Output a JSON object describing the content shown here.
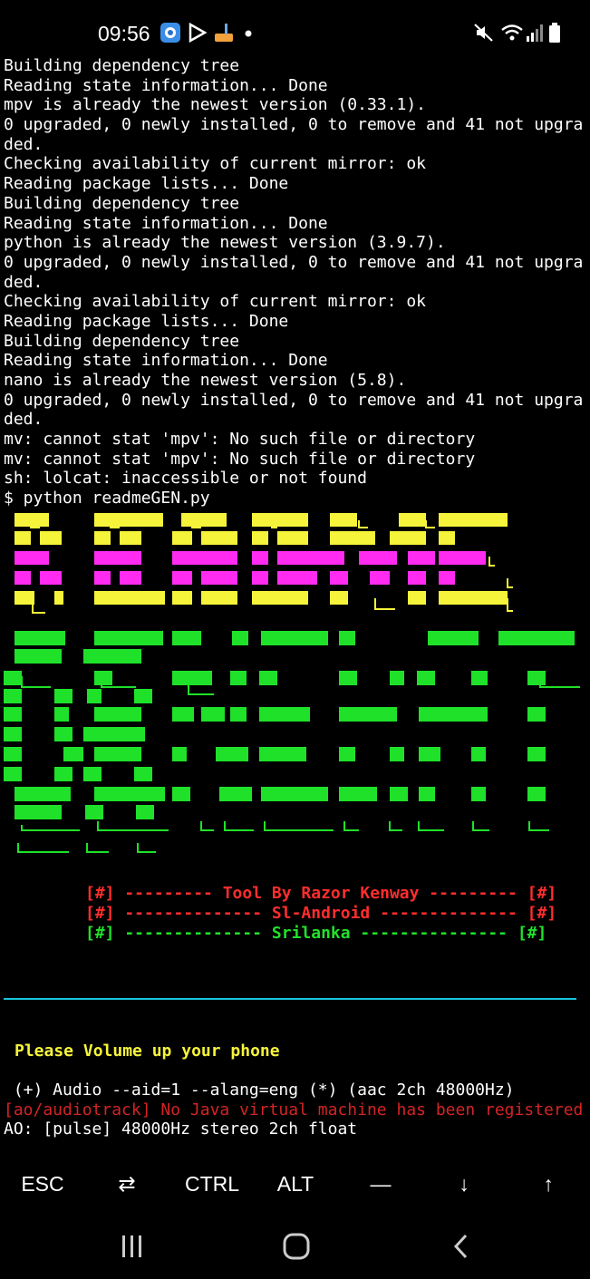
{
  "status_bar": {
    "time": "09:56",
    "left_icons": [
      "gallery-app-icon",
      "play-store-icon",
      "cleaner-broom-icon",
      "notification-dot-icon"
    ],
    "right_icons": [
      "mute-icon",
      "wifi-icon",
      "signal-icon",
      "battery-icon"
    ]
  },
  "terminal": {
    "lines": [
      "Building dependency tree",
      "Reading state information... Done",
      "mpv is already the newest version (0.33.1).",
      "0 upgraded, 0 newly installed, 0 to remove and 41 not upgra",
      "ded.",
      "Checking availability of current mirror: ok",
      "Reading package lists... Done",
      "Building dependency tree",
      "Reading state information... Done",
      "python is already the newest version (3.9.7).",
      "0 upgraded, 0 newly installed, 0 to remove and 41 not upgra",
      "ded.",
      "Checking availability of current mirror: ok",
      "Reading package lists... Done",
      "Building dependency tree",
      "Reading state information... Done",
      "nano is already the newest version (5.8).",
      "0 upgraded, 0 newly installed, 0 to remove and 41 not upgra",
      "ded.",
      "mv: cannot stat 'mpv': No such file or directory",
      "mv: cannot stat 'mpv': No such file or directory",
      "sh: lolcat: inaccessible or not found",
      "$ python readmeGEN.py"
    ]
  },
  "banner": {
    "colors": {
      "yellow": "#f6f43a",
      "magenta": "#ff2bf0",
      "green": "#1fe12a"
    }
  },
  "credits": {
    "line1": "[#] --------- Tool By Razor Kenway --------- [#]",
    "line2": "[#] -------------- Sl-Android -------------- [#]",
    "line3": "[#] -------------- Srilanka --------------- [#]",
    "red": "#ff2d2d",
    "green": "#1fe12a"
  },
  "prompt": {
    "volume_message": "Please Volume up your phone"
  },
  "audio": {
    "line1": " (+) Audio --aid=1 --alang=eng (*) (aac 2ch 48000Hz)",
    "line2": "[ao/audiotrack] No Java virtual machine has been registered",
    "line3": "AO: [pulse] 48000Hz stereo 2ch float"
  },
  "extra_keys": {
    "esc": "ESC",
    "tab": "⇄",
    "ctrl": "CTRL",
    "alt": "ALT",
    "dash": "—",
    "down": "↓",
    "up": "↑"
  },
  "nav_bar": {
    "recents": "recents-icon",
    "home": "home-icon",
    "back": "back-icon"
  },
  "colors": {
    "divider": "#17c4d8",
    "error_red": "#d42424",
    "accent_yellow": "#f6f43a"
  }
}
